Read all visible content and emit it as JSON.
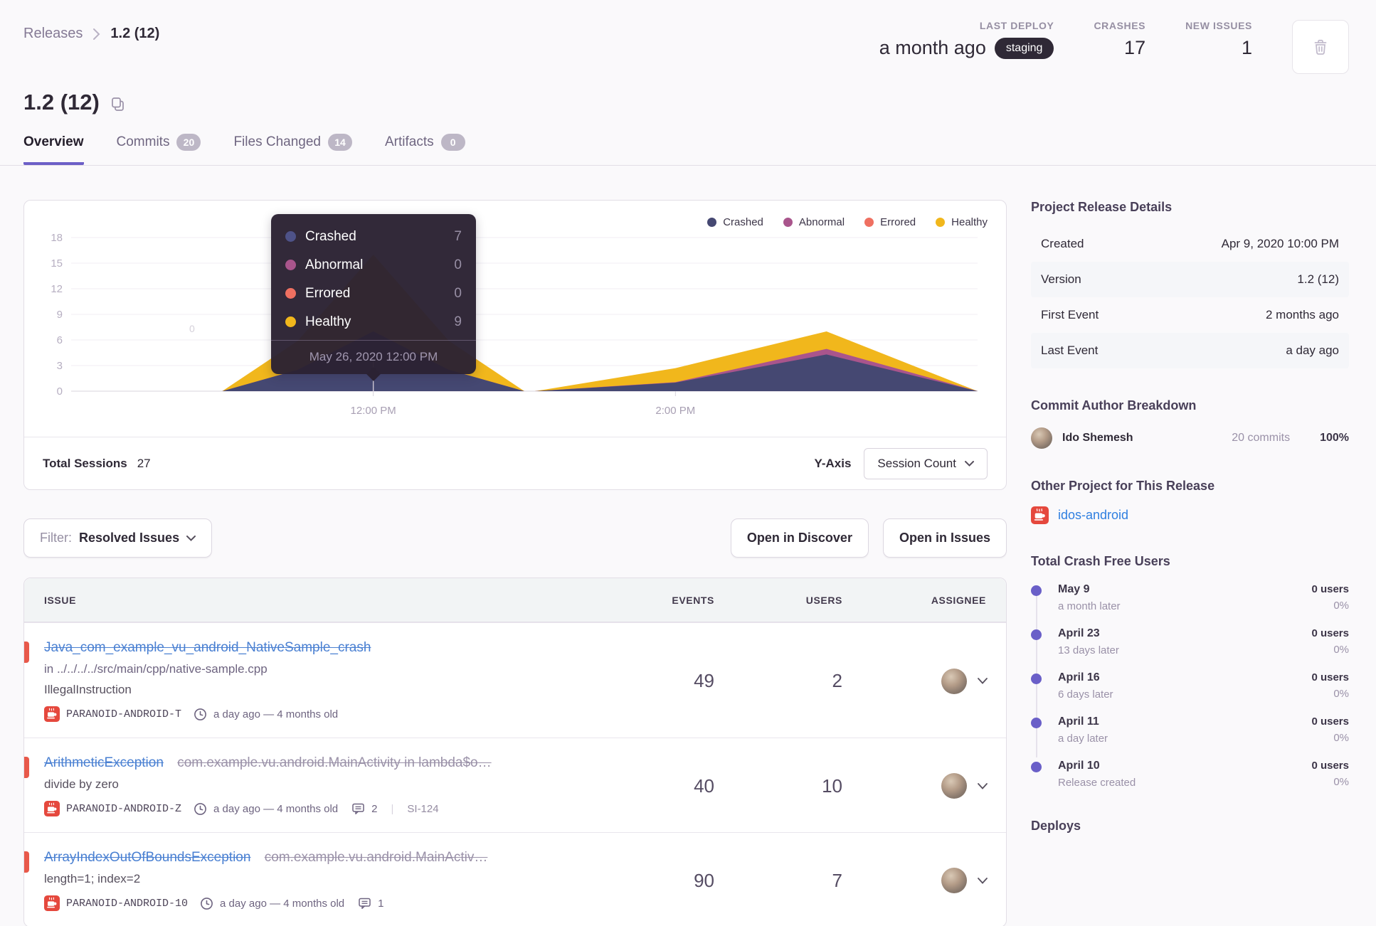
{
  "breadcrumb": {
    "parent": "Releases",
    "current": "1.2 (12)"
  },
  "header": {
    "last_deploy_label": "LAST DEPLOY",
    "last_deploy_value": "a month ago",
    "last_deploy_badge": "staging",
    "crashes_label": "CRASHES",
    "crashes_value": "17",
    "new_issues_label": "NEW ISSUES",
    "new_issues_value": "1"
  },
  "title": "1.2 (12)",
  "tabs": [
    {
      "label": "Overview"
    },
    {
      "label": "Commits",
      "badge": "20"
    },
    {
      "label": "Files Changed",
      "badge": "14"
    },
    {
      "label": "Artifacts",
      "badge": "0"
    }
  ],
  "chart_data": {
    "type": "area",
    "stacked": true,
    "title": "Release sessions over time",
    "x_range_hours": [
      10,
      16
    ],
    "x_hours": [
      10,
      11,
      11.5,
      12,
      12.5,
      13,
      13.07,
      14,
      15,
      16
    ],
    "series": [
      {
        "name": "Crashed",
        "color": "#454872",
        "values": [
          0,
          0,
          2.5,
          7,
          2.5,
          0,
          0,
          1.0,
          4.3,
          0
        ]
      },
      {
        "name": "Abnormal",
        "color": "#a9558c",
        "values": [
          0,
          0,
          0,
          0,
          0,
          0,
          0,
          0.05,
          0.65,
          0
        ]
      },
      {
        "name": "Errored",
        "color": "#ef7061",
        "values": [
          0,
          0,
          0,
          0,
          0,
          0,
          0,
          0,
          0,
          0
        ]
      },
      {
        "name": "Healthy",
        "color": "#f1b71c",
        "values": [
          0,
          0,
          3.4,
          9,
          3.4,
          0,
          0,
          1.65,
          2.05,
          0
        ]
      }
    ],
    "y_ticks": [
      0,
      3,
      6,
      9,
      12,
      15,
      18
    ],
    "ylim": [
      0,
      18
    ],
    "x_tick_labels": [
      {
        "hour": 12,
        "label": "12:00 PM"
      },
      {
        "hour": 14,
        "label": "2:00 PM"
      }
    ],
    "legend_position": "top-right",
    "grid": true,
    "hover_hour": 12,
    "stray_label": "0"
  },
  "tooltip": {
    "rows": [
      {
        "label": "Crashed",
        "value": "7",
        "color": "#4e5288"
      },
      {
        "label": "Abnormal",
        "value": "0",
        "color": "#a9558c"
      },
      {
        "label": "Errored",
        "value": "0",
        "color": "#ef7061"
      },
      {
        "label": "Healthy",
        "value": "9",
        "color": "#f1b71c"
      }
    ],
    "footer": "May 26, 2020 12:00 PM"
  },
  "chart_footer": {
    "total_sessions_label": "Total Sessions",
    "total_sessions_value": "27",
    "y_axis_label": "Y-Axis",
    "y_axis_value": "Session Count"
  },
  "filter": {
    "label": "Filter:",
    "value": "Resolved Issues"
  },
  "actions": {
    "discover": "Open in Discover",
    "issues": "Open in Issues"
  },
  "issues_table": {
    "columns": {
      "issue": "ISSUE",
      "events": "EVENTS",
      "users": "USERS",
      "assignee": "ASSIGNEE"
    },
    "rows": [
      {
        "title": "Java_com_example_vu_android_NativeSample_crash",
        "location": "in ../../../../src/main/cpp/native-sample.cpp",
        "message": "IllegalInstruction",
        "tag": "PARANOID-ANDROID-T",
        "age": "a day ago — 4 months old",
        "events": "49",
        "users": "2"
      },
      {
        "title": "ArithmeticException",
        "culprit": "com.example.vu.android.MainActivity in lambda$o…",
        "message": "divide by zero",
        "tag": "PARANOID-ANDROID-Z",
        "age": "a day ago — 4 months old",
        "comments": "2",
        "short_id": "SI-124",
        "events": "40",
        "users": "10"
      },
      {
        "title": "ArrayIndexOutOfBoundsException",
        "culprit": "com.example.vu.android.MainActiv…",
        "message": "length=1; index=2",
        "tag": "PARANOID-ANDROID-10",
        "age": "a day ago — 4 months old",
        "comments": "1",
        "events": "90",
        "users": "7"
      }
    ]
  },
  "sidebar": {
    "release_details": {
      "heading": "Project Release Details",
      "rows": [
        {
          "label": "Created",
          "value": "Apr 9, 2020 10:00 PM"
        },
        {
          "label": "Version",
          "value": "1.2 (12)"
        },
        {
          "label": "First Event",
          "value": "2 months ago"
        },
        {
          "label": "Last Event",
          "value": "a day ago"
        }
      ]
    },
    "commit_authors": {
      "heading": "Commit Author Breakdown",
      "rows": [
        {
          "name": "Ido Shemesh",
          "commits": "20 commits",
          "percent": "100%"
        }
      ]
    },
    "other_project": {
      "heading": "Other Project for This Release",
      "link": "idos-android"
    },
    "crash_free": {
      "heading": "Total Crash Free Users",
      "items": [
        {
          "date": "May 9",
          "when": "a month later",
          "users": "0 users",
          "percent": "0%"
        },
        {
          "date": "April 23",
          "when": "13 days later",
          "users": "0 users",
          "percent": "0%"
        },
        {
          "date": "April 16",
          "when": "6 days later",
          "users": "0 users",
          "percent": "0%"
        },
        {
          "date": "April 11",
          "when": "a day later",
          "users": "0 users",
          "percent": "0%"
        },
        {
          "date": "April 10",
          "when": "Release created",
          "users": "0 users",
          "percent": "0%"
        }
      ]
    },
    "deploys_heading": "Deploys"
  }
}
